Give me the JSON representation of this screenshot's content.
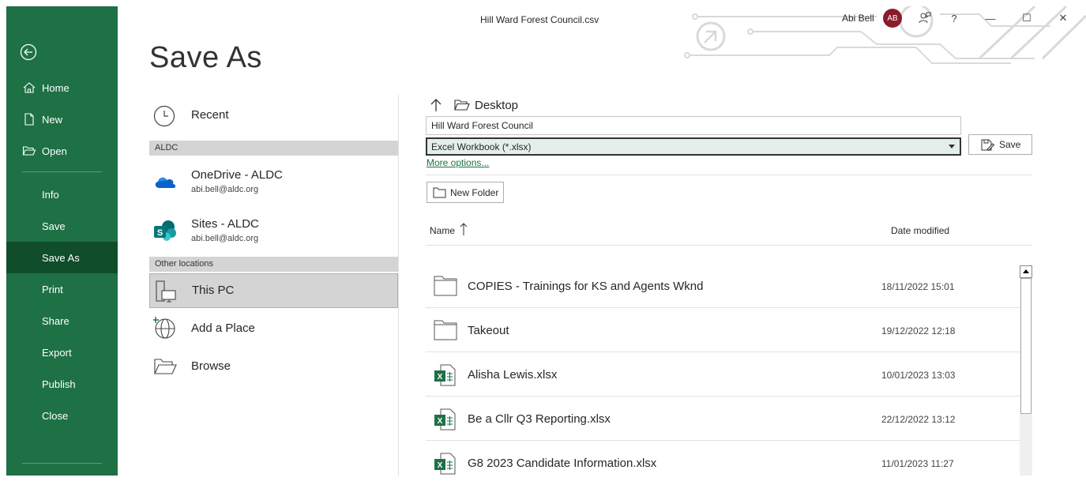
{
  "window": {
    "file_title": "Hill Ward Forest Council.csv",
    "user_name": "Abi Bell",
    "user_initials": "AB",
    "help": "?",
    "minimize": "—",
    "maximize": "☐",
    "close": "✕"
  },
  "nav": {
    "items": [
      {
        "label": "Home"
      },
      {
        "label": "New"
      },
      {
        "label": "Open"
      },
      {
        "label": "Info"
      },
      {
        "label": "Save"
      },
      {
        "label": "Save As"
      },
      {
        "label": "Print"
      },
      {
        "label": "Share"
      },
      {
        "label": "Export"
      },
      {
        "label": "Publish"
      },
      {
        "label": "Close"
      }
    ],
    "active": "Save As"
  },
  "page_title": "Save As",
  "locations": {
    "recent": "Recent",
    "group_aldc": "ALDC",
    "onedrive": {
      "title": "OneDrive - ALDC",
      "email": "abi.bell@aldc.org"
    },
    "sites": {
      "title": "Sites - ALDC",
      "email": "abi.bell@aldc.org"
    },
    "group_other": "Other locations",
    "this_pc": "This PC",
    "add_place": "Add a Place",
    "browse": "Browse"
  },
  "save_pane": {
    "current_folder": "Desktop",
    "filename_value": "Hill Ward Forest Council",
    "filetype_value": "Excel Workbook (*.xlsx)",
    "save_label": "Save",
    "more_options": "More options...",
    "new_folder": "New Folder",
    "col_name": "Name",
    "col_date": "Date modified",
    "files": [
      {
        "name": "COPIES - Trainings for KS and Agents Wknd",
        "date": "18/11/2022 15:01",
        "type": "folder"
      },
      {
        "name": "Takeout",
        "date": "19/12/2022 12:18",
        "type": "folder"
      },
      {
        "name": "Alisha Lewis.xlsx",
        "date": "10/01/2023 13:03",
        "type": "excel"
      },
      {
        "name": "Be a Cllr Q3 Reporting.xlsx",
        "date": "22/12/2022 13:12",
        "type": "excel"
      },
      {
        "name": "G8 2023 Candidate Information.xlsx",
        "date": "11/01/2023 11:27",
        "type": "excel"
      }
    ]
  },
  "colors": {
    "nav_green": "#1e7145",
    "nav_active": "#0f4d2b",
    "avatar": "#8a1c2b",
    "link": "#1e7145"
  }
}
